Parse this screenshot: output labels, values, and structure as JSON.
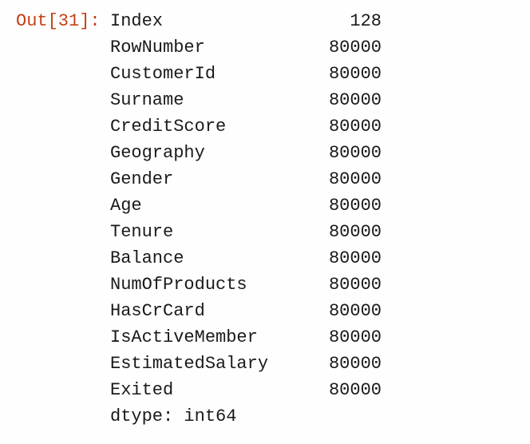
{
  "prompt": {
    "label": "Out[31]:"
  },
  "series": {
    "rows": [
      {
        "key": "Index",
        "value": "128"
      },
      {
        "key": "RowNumber",
        "value": "80000"
      },
      {
        "key": "CustomerId",
        "value": "80000"
      },
      {
        "key": "Surname",
        "value": "80000"
      },
      {
        "key": "CreditScore",
        "value": "80000"
      },
      {
        "key": "Geography",
        "value": "80000"
      },
      {
        "key": "Gender",
        "value": "80000"
      },
      {
        "key": "Age",
        "value": "80000"
      },
      {
        "key": "Tenure",
        "value": "80000"
      },
      {
        "key": "Balance",
        "value": "80000"
      },
      {
        "key": "NumOfProducts",
        "value": "80000"
      },
      {
        "key": "HasCrCard",
        "value": "80000"
      },
      {
        "key": "IsActiveMember",
        "value": "80000"
      },
      {
        "key": "EstimatedSalary",
        "value": "80000"
      },
      {
        "key": "Exited",
        "value": "80000"
      }
    ],
    "dtype_line": "dtype: int64"
  }
}
